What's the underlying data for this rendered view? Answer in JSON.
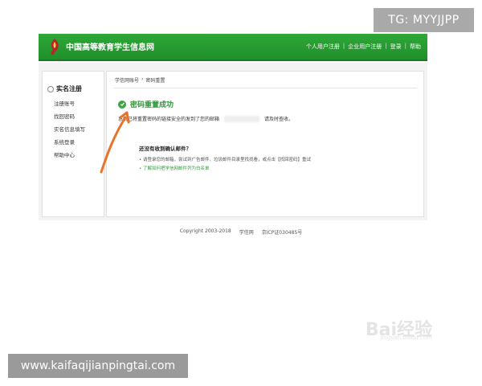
{
  "watermark_top": "TG: MYYJJPP",
  "header": {
    "title": "中国高等教育学生信息网",
    "links": [
      "个人用户注册",
      "企业用户注册",
      "登录",
      "帮助"
    ]
  },
  "sidebar": {
    "title": "实名注册",
    "items": [
      {
        "label": "注册账号"
      },
      {
        "label": "找回密码"
      },
      {
        "label": "实名信息填写"
      },
      {
        "label": "系统登录"
      },
      {
        "label": "帮助中心"
      }
    ]
  },
  "main": {
    "breadcrumb": [
      "学信网账号",
      "密码重置"
    ],
    "breadcrumb_sep": "›",
    "success_title": "密码重置成功",
    "message_before": "系统已将重置密码的链接安全的发到了您的邮箱",
    "message_after": "请及时查收。",
    "help": {
      "title": "还没有收到确认邮件？",
      "lines": [
        "• 请登录您的邮箱，尝试到广告邮件、垃圾邮件目录里找找看，或点击【找回密码】重试",
        "• 了解如何把学信网邮件列为白名单"
      ]
    }
  },
  "footer": {
    "copyright": "Copyright 2003-2018",
    "site": "学信网",
    "icp": "京ICP证030485号"
  },
  "watermark_bottom": {
    "url": "www.kaifaqijianpingtai.com",
    "right_brand": "Bai经验",
    "right_sub": "jingyan.baidu.com"
  },
  "colors": {
    "header_green": "#2fa838",
    "success_green": "#2e9b37",
    "annotation_orange": "#e8742a"
  }
}
